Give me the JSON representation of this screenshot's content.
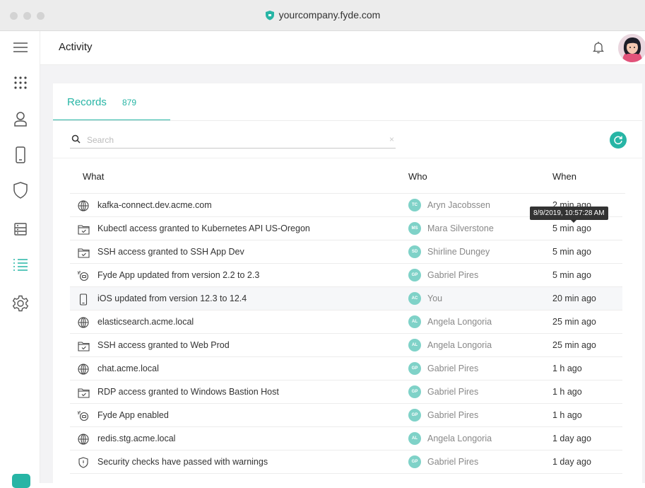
{
  "browser": {
    "url": "yourcompany.fyde.com"
  },
  "header": {
    "title": "Activity"
  },
  "sidebar": {
    "items": [
      {
        "icon": "menu-icon"
      },
      {
        "icon": "apps-icon"
      },
      {
        "icon": "user-icon"
      },
      {
        "icon": "device-icon"
      },
      {
        "icon": "shield-icon"
      },
      {
        "icon": "server-icon"
      },
      {
        "icon": "list-icon",
        "active": true
      },
      {
        "icon": "gear-icon"
      }
    ]
  },
  "tabs": {
    "records_label": "Records",
    "records_count": "879"
  },
  "search": {
    "placeholder": "Search",
    "clear": "×"
  },
  "table": {
    "columns": [
      "What",
      "Who",
      "When"
    ],
    "rows": [
      {
        "icon": "globe-icon",
        "what": "kafka-connect.dev.acme.com",
        "initials": "TC",
        "who": "Aryn Jacobssen",
        "when": "2 min ago"
      },
      {
        "icon": "folder-check-icon",
        "what": "Kubectl access granted to Kubernetes API US-Oregon",
        "initials": "MS",
        "who": "Mara Silverstone",
        "when": "5 min ago"
      },
      {
        "icon": "folder-check-icon",
        "what": "SSH access granted to SSH App Dev",
        "initials": "SD",
        "who": "Shirline Dungey",
        "when": "5 min ago"
      },
      {
        "icon": "fyde-app-icon",
        "what": "Fyde App updated from version 2.2 to 2.3",
        "initials": "GP",
        "who": "Gabriel Pires",
        "when": "5 min ago"
      },
      {
        "icon": "phone-icon",
        "what": "iOS updated from version 12.3 to 12.4",
        "initials": "AC",
        "who": "You",
        "when": "20 min ago"
      },
      {
        "icon": "globe-icon",
        "what": "elasticsearch.acme.local",
        "initials": "AL",
        "who": "Angela Longoria",
        "when": "25 min ago"
      },
      {
        "icon": "folder-check-icon",
        "what": "SSH access granted to Web Prod",
        "initials": "AL",
        "who": "Angela Longoria",
        "when": "25 min ago"
      },
      {
        "icon": "globe-icon",
        "what": "chat.acme.local",
        "initials": "GP",
        "who": "Gabriel Pires",
        "when": "1 h ago"
      },
      {
        "icon": "folder-check-icon",
        "what": "RDP access granted to Windows Bastion Host",
        "initials": "GP",
        "who": "Gabriel Pires",
        "when": "1 h ago"
      },
      {
        "icon": "fyde-app-icon",
        "what": "Fyde App enabled",
        "initials": "GP",
        "who": "Gabriel Pires",
        "when": "1 h ago"
      },
      {
        "icon": "globe-icon",
        "what": "redis.stg.acme.local",
        "initials": "AL",
        "who": "Angela Longoria",
        "when": "1 day ago"
      },
      {
        "icon": "shield-warning-icon",
        "what": "Security checks have passed with warnings",
        "initials": "GP",
        "who": "Gabriel Pires",
        "when": "1 day ago"
      }
    ]
  },
  "tooltip": {
    "text": "8/9/2019, 10:57:28 AM"
  },
  "colors": {
    "accent": "#27b5a5",
    "badge": "#7fd2c8"
  }
}
